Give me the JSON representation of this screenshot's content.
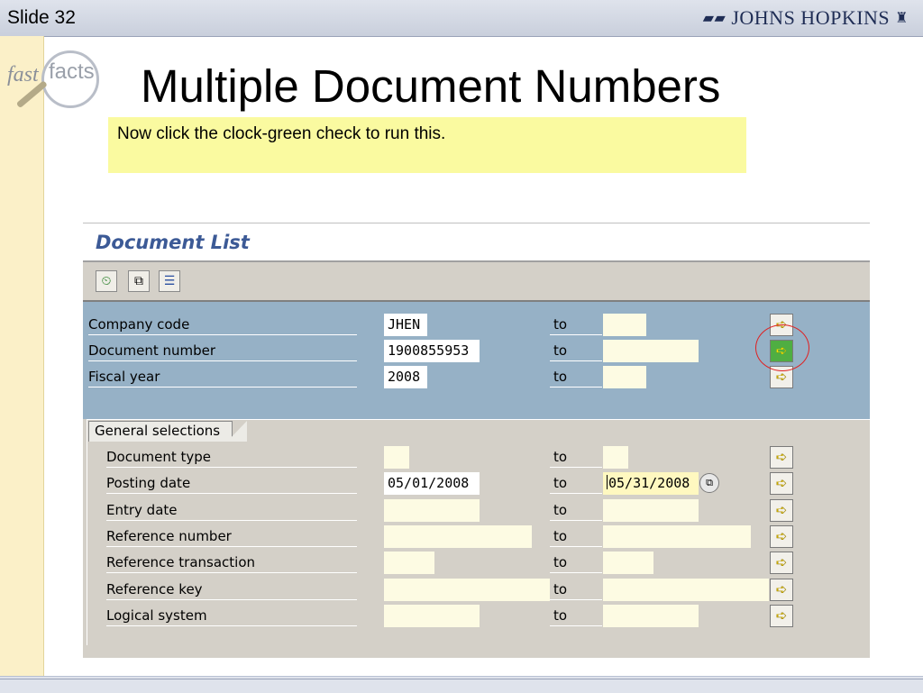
{
  "slide": {
    "number_label": "Slide 32",
    "logo_text": "JOHNS HOPKINS",
    "title": "Multiple Document Numbers"
  },
  "fastfacts": {
    "fast": "fast",
    "facts": "facts"
  },
  "note": "Now click the clock-green check to run this.",
  "sap": {
    "title": "Document List",
    "toolbar": [
      {
        "name": "execute-clock-icon",
        "glyph": "⏲"
      },
      {
        "name": "get-variant-icon",
        "glyph": "⧉"
      },
      {
        "name": "selection-options-icon",
        "glyph": "☰"
      }
    ],
    "to_label": "to",
    "main_rows": [
      {
        "label": "Company code",
        "from": "JHEN",
        "to": ""
      },
      {
        "label": "Document number",
        "from": "1900855953",
        "to": ""
      },
      {
        "label": "Fiscal year",
        "from": "2008",
        "to": ""
      }
    ],
    "general_tab": "General selections",
    "general_rows": [
      {
        "label": "Document type",
        "from": "",
        "to": ""
      },
      {
        "label": "Posting date",
        "from": "05/01/2008",
        "to": "05/31/2008"
      },
      {
        "label": "Entry date",
        "from": "",
        "to": ""
      },
      {
        "label": "Reference number",
        "from": "",
        "to": ""
      },
      {
        "label": "Reference transaction",
        "from": "",
        "to": ""
      },
      {
        "label": "Reference key",
        "from": "",
        "to": ""
      },
      {
        "label": "Logical system",
        "from": "",
        "to": ""
      }
    ],
    "multiple_selection_icon": "arrow-right-icon",
    "multiple_selection_active_color": "#4fae42",
    "highlight_color": "#e02020"
  }
}
